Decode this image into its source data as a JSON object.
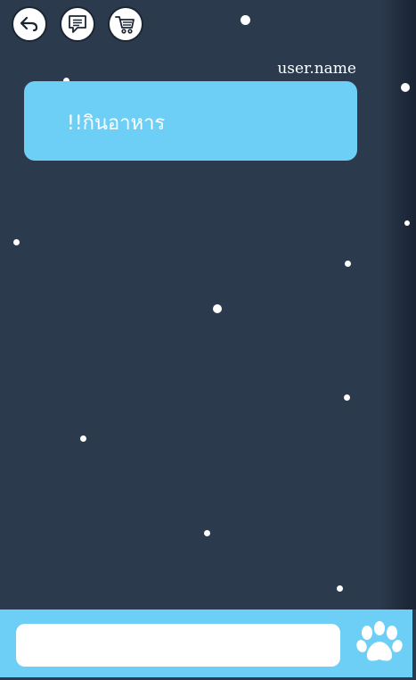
{
  "toolbar": {
    "buttons": [
      {
        "name": "back-button",
        "icon": "back-arrow-icon"
      },
      {
        "name": "chat-button",
        "icon": "chat-bubble-icon"
      },
      {
        "name": "cart-button",
        "icon": "shopping-cart-icon"
      }
    ]
  },
  "chat": {
    "user_name": "user.name",
    "messages": [
      {
        "text": "!!กินอาหาร"
      }
    ]
  },
  "composer": {
    "input_value": "",
    "input_placeholder": "",
    "send_icon": "paw-icon"
  },
  "colors": {
    "background": "#2b3a4d",
    "accent": "#6dcff5",
    "text": "#ffffff"
  }
}
